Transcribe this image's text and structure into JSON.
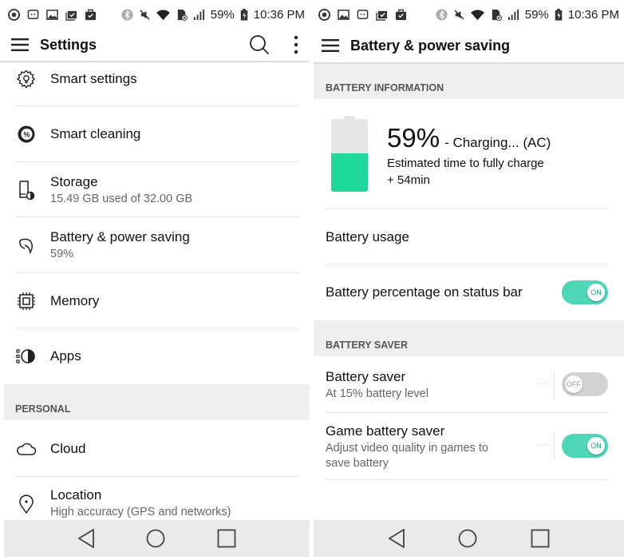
{
  "status_bar": {
    "battery_percent": "59%",
    "time": "10:36 PM",
    "left_icons": [
      "no-disturb-icon",
      "messenger-icon",
      "gallery-icon",
      "task-icon",
      "briefcase-check-icon"
    ],
    "right_icons": [
      "bluetooth-icon",
      "mute-icon",
      "wifi-icon",
      "sim-icon",
      "signal-icon"
    ]
  },
  "left": {
    "app_bar": {
      "title": "Settings"
    },
    "items": [
      {
        "label": "Smart settings",
        "icon": "smart-settings-icon"
      },
      {
        "label": "Smart cleaning",
        "icon": "smart-cleaning-icon"
      },
      {
        "label": "Storage",
        "sub": "15.49 GB used of 32.00 GB",
        "icon": "storage-icon"
      },
      {
        "label": "Battery & power saving",
        "sub": "59%",
        "icon": "battery-leaf-icon"
      },
      {
        "label": "Memory",
        "icon": "memory-chip-icon"
      },
      {
        "label": "Apps",
        "icon": "apps-icon"
      }
    ],
    "section_personal": "PERSONAL",
    "personal_items": [
      {
        "label": "Cloud",
        "icon": "cloud-icon"
      },
      {
        "label": "Location",
        "sub": "High accuracy (GPS and networks)",
        "icon": "location-pin-icon"
      }
    ]
  },
  "right": {
    "app_bar": {
      "title": "Battery & power saving"
    },
    "section_info": "BATTERY INFORMATION",
    "battery": {
      "level_percent": 59,
      "percent_text": "59%",
      "status": "- Charging... (AC)",
      "estimate_line1": "Estimated time to fully charge",
      "estimate_line2": "+ 54min",
      "fill_color": "#1fd69b"
    },
    "battery_usage": "Battery usage",
    "battery_percentage_on_status_bar": {
      "label": "Battery percentage on status bar",
      "state": "ON"
    },
    "section_saver": "BATTERY SAVER",
    "battery_saver": {
      "label": "Battery saver",
      "sub": "At 15% battery level",
      "state": "OFF"
    },
    "game_battery_saver": {
      "label": "Game battery saver",
      "sub_line1": "Adjust video quality in games to",
      "sub_line2": "save battery",
      "state": "ON"
    }
  },
  "colors": {
    "accent": "#4fd6b9",
    "section_bg": "#eeeff1",
    "nav_bg": "#e9eaec"
  }
}
